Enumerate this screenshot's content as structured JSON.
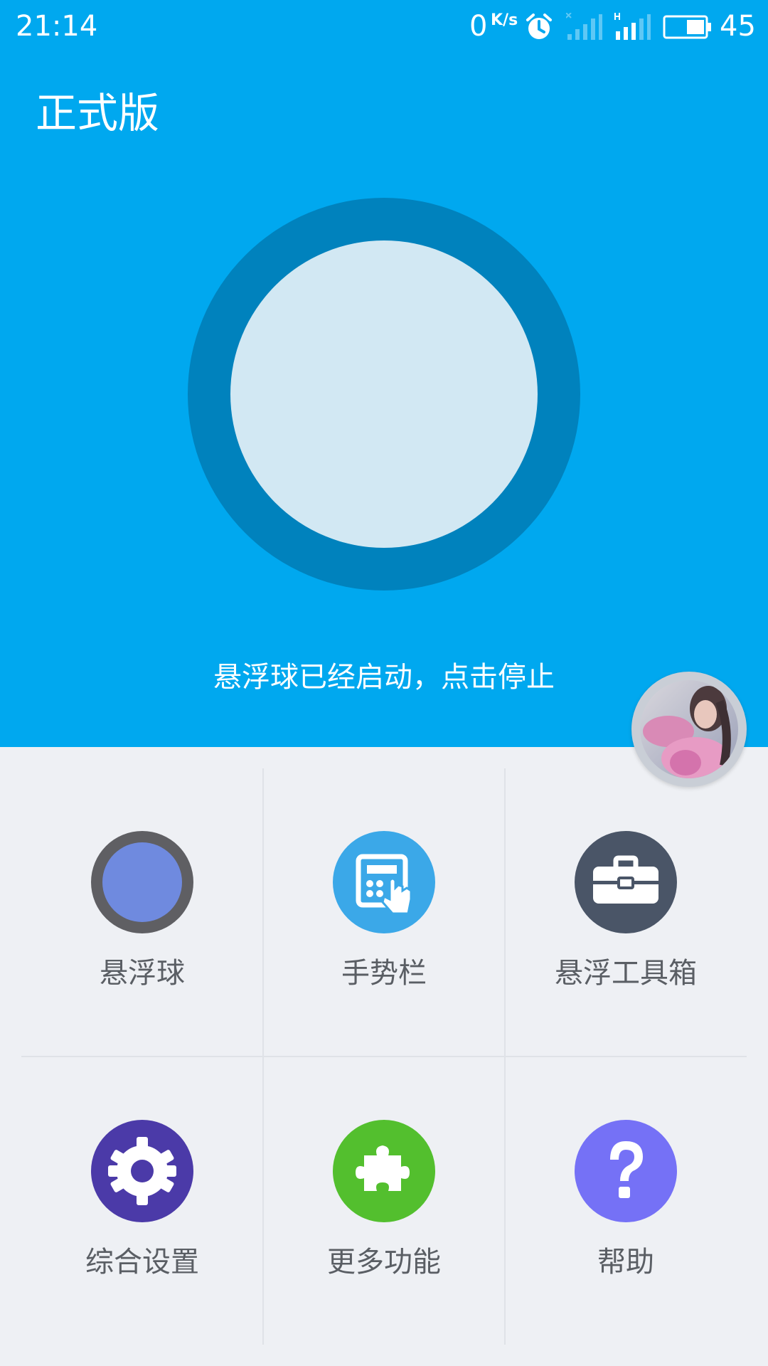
{
  "status_bar": {
    "time": "21:14",
    "speed_value": "0",
    "speed_unit": "K/s",
    "battery": "45"
  },
  "header": {
    "title": "正式版"
  },
  "main": {
    "status_message": "悬浮球已经启动，点击停止"
  },
  "colors": {
    "primary_blue": "#00a8ef",
    "ring_dark_blue": "#0082bd",
    "ring_inner": "#d2e8f3",
    "background": "#eef0f4"
  },
  "grid": {
    "items": [
      {
        "label": "悬浮球",
        "icon": "float-ball-icon",
        "color": "#5f5f63"
      },
      {
        "label": "手势栏",
        "icon": "gesture-bar-icon",
        "color": "#3ba8e8"
      },
      {
        "label": "悬浮工具箱",
        "icon": "toolbox-icon",
        "color": "#4a5567"
      },
      {
        "label": "综合设置",
        "icon": "gear-icon",
        "color": "#4b3aa8"
      },
      {
        "label": "更多功能",
        "icon": "puzzle-icon",
        "color": "#53bf2e"
      },
      {
        "label": "帮助",
        "icon": "help-icon",
        "color": "#7571f6"
      }
    ]
  }
}
